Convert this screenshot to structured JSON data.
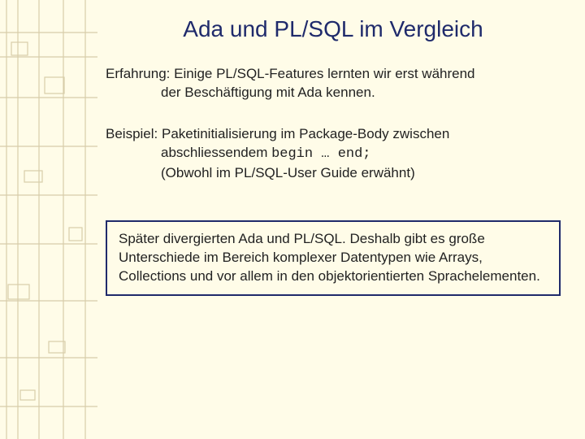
{
  "title": "Ada und PL/SQL im Vergleich",
  "para1_lead": "Erfahrung: Einige PL/SQL-Features lernten wir erst während",
  "para1_cont": "der Beschäftigung mit Ada kennen.",
  "para2_lead": "Beispiel: Paketinitialisierung im Package-Body zwischen",
  "para2_cont1a": "abschliessendem ",
  "para2_code": "begin … end;",
  "para2_cont2": "(Obwohl im PL/SQL-User Guide erwähnt)",
  "box_text": "Später divergierten Ada und PL/SQL. Deshalb gibt es große Unterschiede im Bereich komplexer Datentypen wie Arrays, Collections und vor allem in den objektorientierten Sprach­elementen."
}
